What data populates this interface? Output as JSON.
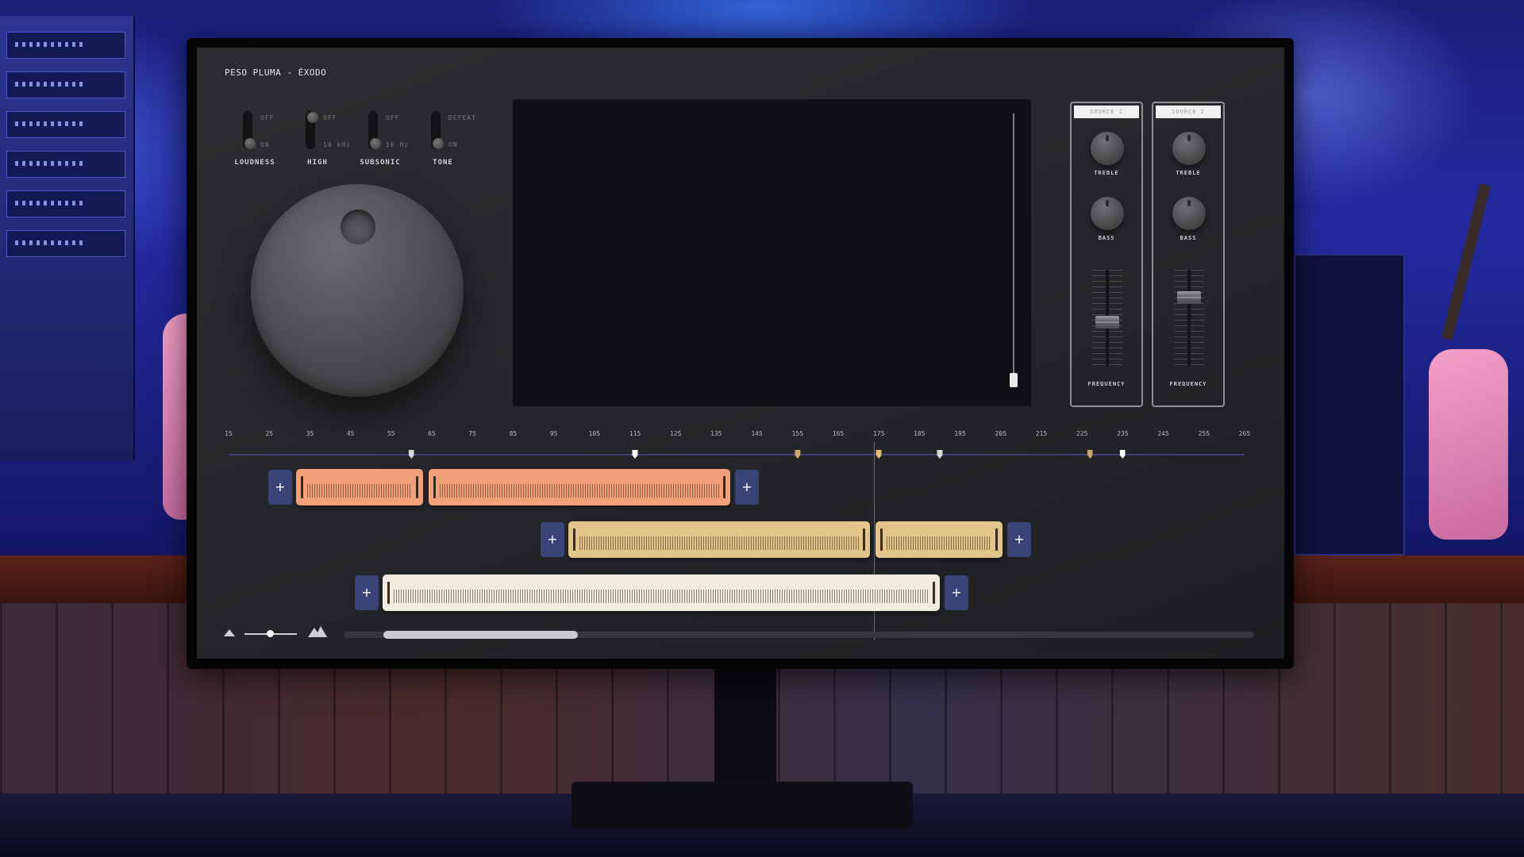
{
  "song": {
    "title": "PESO PLUMA - ÉXODO"
  },
  "switches": [
    {
      "label": "LOUDNESS",
      "top": "OFF",
      "bottom": "ON",
      "state": "on"
    },
    {
      "label": "HIGH",
      "top": "OFF",
      "bottom": "10 kHz",
      "state": "off"
    },
    {
      "label": "SUBSONIC",
      "top": "OFF",
      "bottom": "16 Hz",
      "state": "on"
    },
    {
      "label": "TONE",
      "top": "DEFEAT",
      "bottom": "ON",
      "state": "on"
    }
  ],
  "sources": [
    {
      "name": "SOURCE 1",
      "treble": "TREBLE",
      "bass": "BASS",
      "fader_label": "FREQUENCY",
      "fader_level": 0.45
    },
    {
      "name": "SOURCE 2",
      "treble": "TREBLE",
      "bass": "BASS",
      "fader_label": "FREQUENCY",
      "fader_level": 0.75
    }
  ],
  "ruler": {
    "ticks": [
      "15",
      "25",
      "35",
      "45",
      "55",
      "65",
      "75",
      "85",
      "95",
      "105",
      "115",
      "125",
      "135",
      "145",
      "155",
      "165",
      "175",
      "185",
      "195",
      "205",
      "215",
      "225",
      "235",
      "245",
      "255",
      "265"
    ],
    "markers": [
      {
        "value": 60,
        "color": "#d8d8d8"
      },
      {
        "value": 115,
        "color": "#ffffff"
      },
      {
        "value": 155,
        "color": "#c9a66a"
      },
      {
        "value": 175,
        "color": "#e0c070"
      },
      {
        "value": 190,
        "color": "#d8d8d8"
      },
      {
        "value": 227,
        "color": "#c9a66a"
      },
      {
        "value": 235,
        "color": "#ffffff"
      }
    ],
    "playhead": 175
  },
  "tracks": [
    {
      "clips": [
        {
          "color": "#f2a07a"
        },
        {
          "color": "#f2a07a"
        }
      ],
      "add_label": "+"
    },
    {
      "clips": [
        {
          "color": "#e3c48a"
        },
        {
          "color": "#e3c48a"
        }
      ],
      "add_label": "+"
    },
    {
      "clips": [
        {
          "color": "#f0ece0"
        }
      ],
      "add_label": "+"
    }
  ],
  "colors": {
    "accent_orange": "#f2a07a",
    "accent_gold": "#e3c48a",
    "accent_cream": "#f0ece0",
    "button_blue": "#3a4376"
  },
  "icons": {
    "zoom_out": "mountain-small-icon",
    "zoom_in": "mountains-large-icon",
    "add": "plus-icon"
  }
}
